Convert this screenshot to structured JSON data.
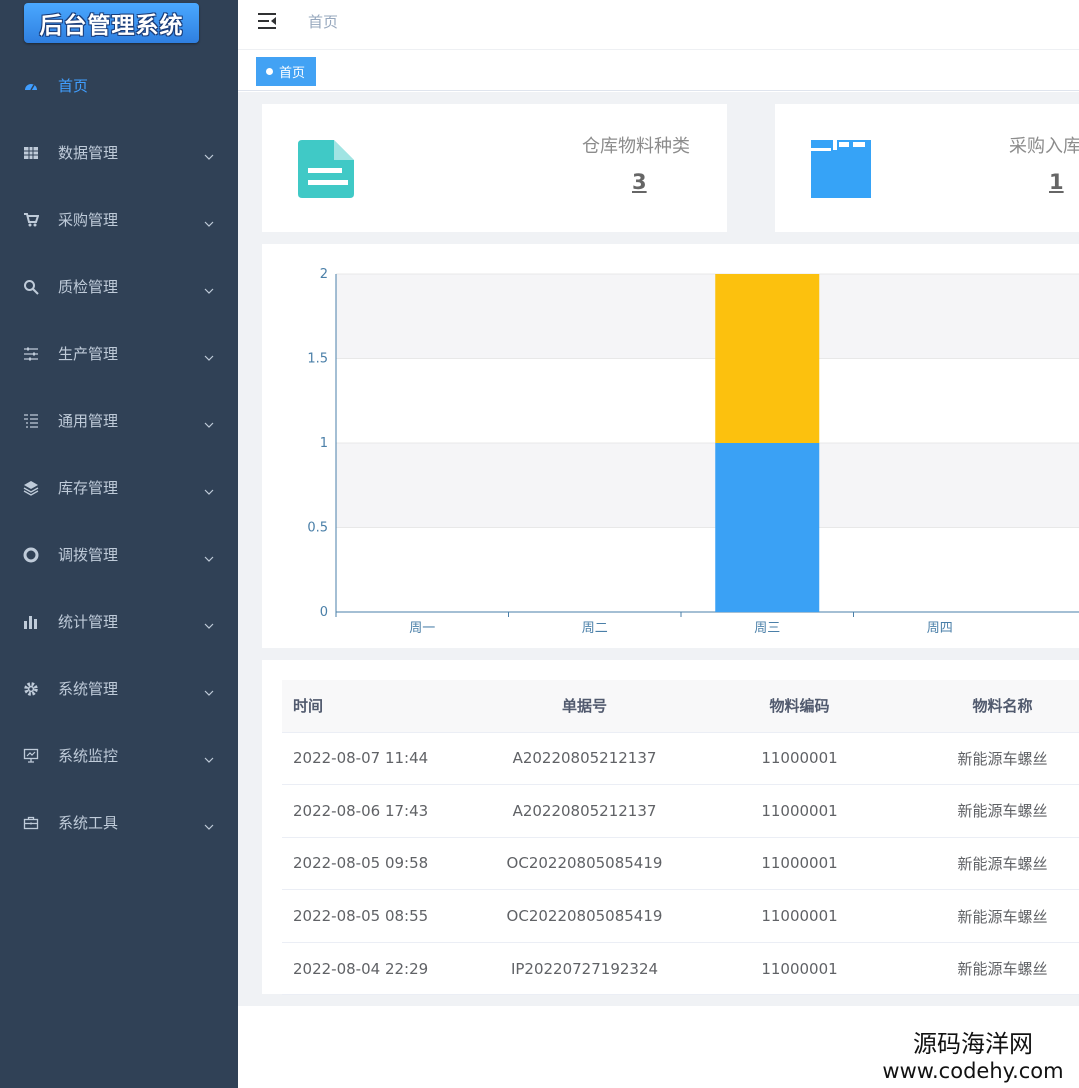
{
  "app": {
    "logo": "后台管理系统"
  },
  "sidebar": {
    "items": [
      {
        "label": "首页",
        "icon": "dashboard-icon",
        "active": true
      },
      {
        "label": "数据管理",
        "icon": "table-icon"
      },
      {
        "label": "采购管理",
        "icon": "cart-icon"
      },
      {
        "label": "质检管理",
        "icon": "search-icon"
      },
      {
        "label": "生产管理",
        "icon": "sliders-icon"
      },
      {
        "label": "通用管理",
        "icon": "list-icon"
      },
      {
        "label": "库存管理",
        "icon": "layers-icon"
      },
      {
        "label": "调拨管理",
        "icon": "lifebuoy-icon"
      },
      {
        "label": "统计管理",
        "icon": "bar-chart-icon"
      },
      {
        "label": "系统管理",
        "icon": "gear-icon"
      },
      {
        "label": "系统监控",
        "icon": "monitor-icon"
      },
      {
        "label": "系统工具",
        "icon": "toolbox-icon"
      }
    ],
    "colors": {
      "background": "#304156",
      "text": "#bfcbd9",
      "active": "#409eff"
    }
  },
  "header": {
    "breadcrumb": "首页"
  },
  "tags": [
    {
      "label": "首页",
      "active": true
    }
  ],
  "stats": [
    {
      "title": "仓库物料种类",
      "value": "3",
      "icon": "document-icon",
      "color": "#40c9c6"
    },
    {
      "title": "采购入库",
      "value": "1",
      "icon": "folder-icon",
      "color": "#36a3f7"
    }
  ],
  "chart_data": {
    "type": "bar",
    "stacked": true,
    "categories": [
      "周一",
      "周二",
      "周三",
      "周四"
    ],
    "series": [
      {
        "values": [
          0,
          0,
          1,
          0
        ],
        "color": "#3aa1f5"
      },
      {
        "values": [
          0,
          0,
          1,
          0
        ],
        "color": "#fcc10e"
      }
    ],
    "ylim": [
      0,
      2
    ],
    "yticks": [
      "0",
      "0.5",
      "1",
      "1.5",
      "2"
    ],
    "grid": true
  },
  "table": {
    "columns": [
      "时间",
      "单据号",
      "物料编码",
      "物料名称"
    ],
    "rows": [
      [
        "2022-08-07 11:44",
        "A20220805212137",
        "11000001",
        "新能源车螺丝"
      ],
      [
        "2022-08-06 17:43",
        "A20220805212137",
        "11000001",
        "新能源车螺丝"
      ],
      [
        "2022-08-05 09:58",
        "OC20220805085419",
        "11000001",
        "新能源车螺丝"
      ],
      [
        "2022-08-05 08:55",
        "OC20220805085419",
        "11000001",
        "新能源车螺丝"
      ],
      [
        "2022-08-04 22:29",
        "IP20220727192324",
        "11000001",
        "新能源车螺丝"
      ]
    ]
  },
  "watermark": {
    "line1": "源码海洋网",
    "line2": "www.codehy.com"
  }
}
